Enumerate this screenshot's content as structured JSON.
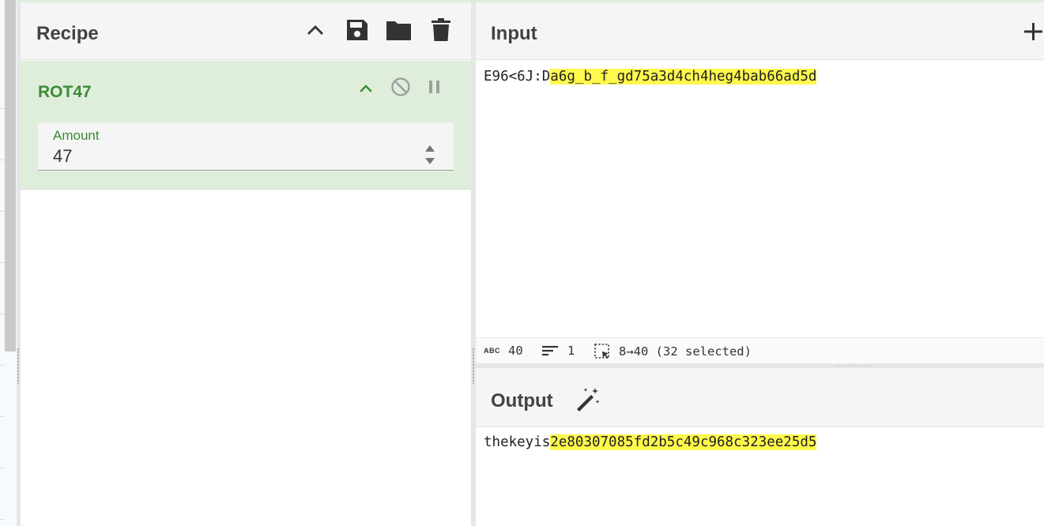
{
  "recipe": {
    "title": "Recipe",
    "icons": [
      "chevron-up-icon",
      "save-icon",
      "folder-icon",
      "trash-icon"
    ],
    "operation": {
      "name": "ROT47",
      "icons": [
        "chevron-up-icon",
        "disable-icon",
        "pause-icon"
      ],
      "amount_label": "Amount",
      "amount_value": "47"
    }
  },
  "input": {
    "title": "Input",
    "add_icon": "plus-icon",
    "text_prefix": "E96<6J:D",
    "text_selected": "a6g_b_f_gd75a3d4ch4heg4bab66ad5d",
    "status": {
      "length": "40",
      "lines": "1",
      "selection": "8→40 (32 selected)"
    }
  },
  "output": {
    "title": "Output",
    "magic_icon": "magic-wand-icon",
    "text_prefix": "thekeyis",
    "text_selected": "2e80307085fd2b5c49c968c323ee25d5"
  },
  "colors": {
    "accent_green": "#3c8a37",
    "operation_bg": "#dfeedb",
    "highlight": "#fff84d"
  }
}
